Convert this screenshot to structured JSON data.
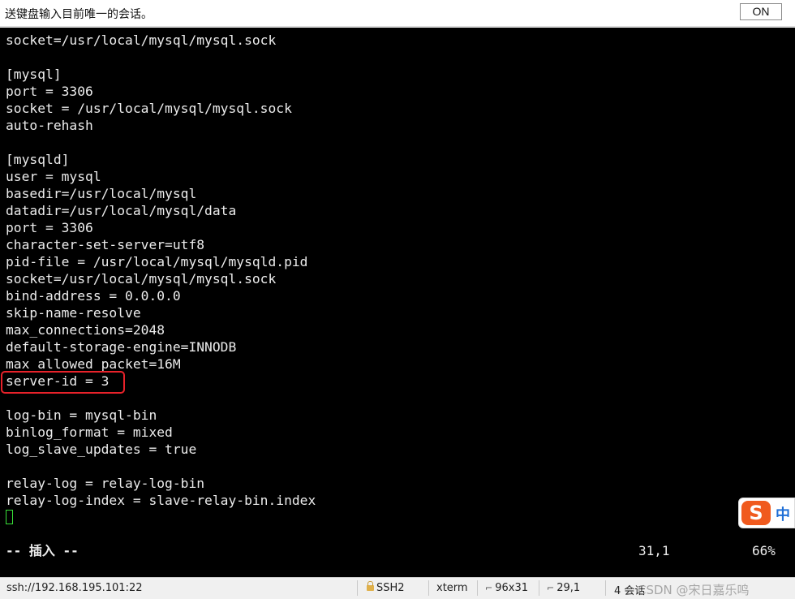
{
  "topbar": {
    "label": "送键盘输入目前唯一的会话。",
    "toggle_label": "ON"
  },
  "terminal": {
    "lines": [
      "socket=/usr/local/mysql/mysql.sock",
      "",
      "[mysql]",
      "port = 3306",
      "socket = /usr/local/mysql/mysql.sock",
      "auto-rehash",
      "",
      "[mysqld]",
      "user = mysql",
      "basedir=/usr/local/mysql",
      "datadir=/usr/local/mysql/data",
      "port = 3306",
      "character-set-server=utf8",
      "pid-file = /usr/local/mysql/mysqld.pid",
      "socket=/usr/local/mysql/mysql.sock",
      "bind-address = 0.0.0.0",
      "skip-name-resolve",
      "max_connections=2048",
      "default-storage-engine=INNODB",
      "max_allowed_packet=16M",
      "server-id = 3",
      "",
      "log-bin = mysql-bin",
      "binlog_format = mixed",
      "log_slave_updates = true",
      "",
      "relay-log = relay-log-bin",
      "relay-log-index = slave-relay-bin.index"
    ],
    "mode": "-- 插入 --",
    "cursor_position": "31,1",
    "scroll_percent": "66%",
    "highlight_color": "#e8222a",
    "cursor_color": "#39e239"
  },
  "ime": {
    "logo": "S",
    "mode": "中",
    "logo_color": "#f05a1e"
  },
  "statusbar": {
    "connection": "ssh://192.168.195.101:22",
    "protocol": "SSH2",
    "terminal_type": "xterm",
    "size": "96x31",
    "position": "29,1",
    "sessions": "4 会话",
    "watermark": "CSDN @宋日嘉乐鸣"
  }
}
